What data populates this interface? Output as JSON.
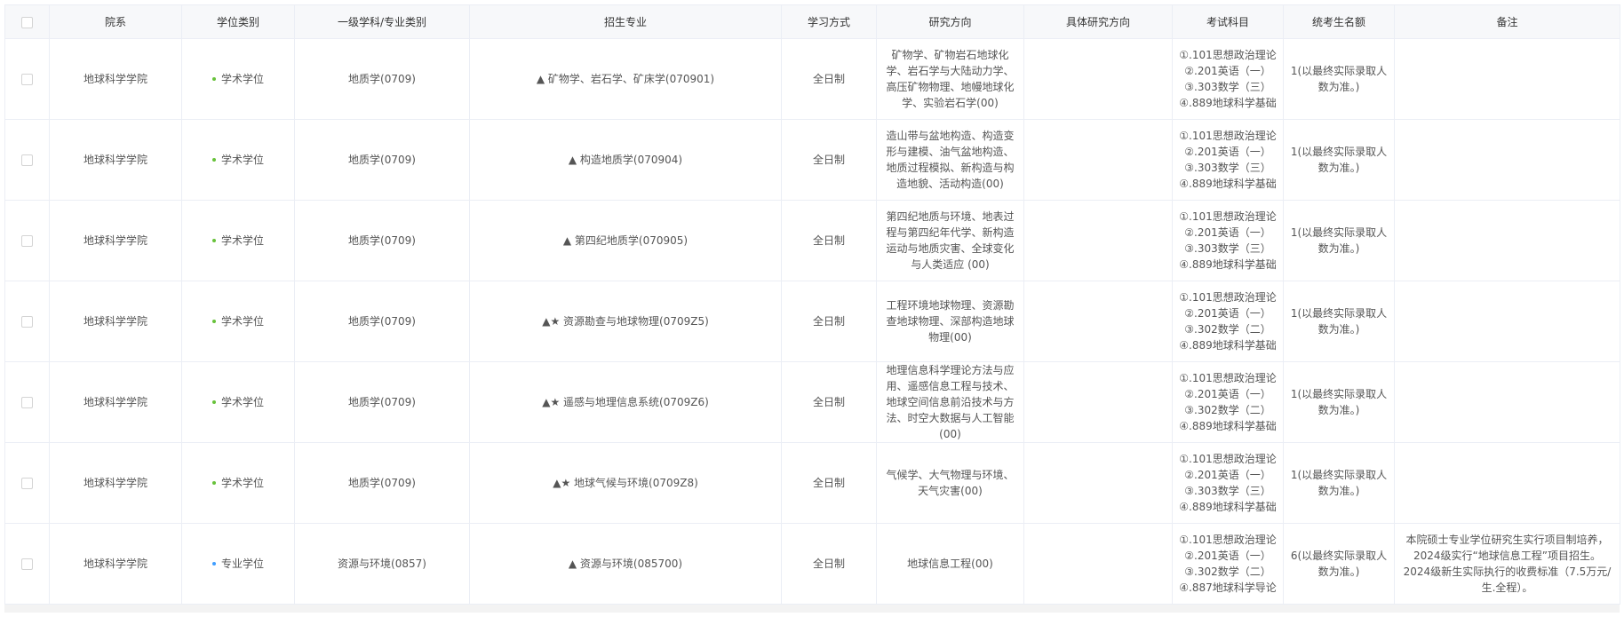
{
  "headers": [
    "院系",
    "学位类别",
    "一级学科/专业类别",
    "招生专业",
    "学习方式",
    "研究方向",
    "具体研究方向",
    "考试科目",
    "统考生名额",
    "备注"
  ],
  "colors": {
    "academic": "#67c23a",
    "professional": "#409eff",
    "border": "#ebeef5",
    "header_bg": "#f7f8fa"
  },
  "rows": [
    {
      "dept": "地球科学学院",
      "degree": "学术学位",
      "degree_kind": "academic",
      "discipline": "地质学(0709)",
      "major": "▲ 矿物学、岩石学、矿床学(070901)",
      "mode": "全日制",
      "direction": "矿物学、矿物岩石地球化学、岩石学与大陆动力学、高压矿物物理、地幔地球化学、实验岩石学(00)",
      "specific": "",
      "subjects": [
        "①.101思想政治理论",
        "②.201英语（一）",
        "③.303数学（三）",
        "④.889地球科学基础"
      ],
      "quota": "1(以最终实际录取人数为准。)",
      "note": ""
    },
    {
      "dept": "地球科学学院",
      "degree": "学术学位",
      "degree_kind": "academic",
      "discipline": "地质学(0709)",
      "major": "▲ 构造地质学(070904)",
      "mode": "全日制",
      "direction": "造山带与盆地构造、构造变形与建模、油气盆地构造、地质过程模拟、新构造与构造地貌、活动构造(00)",
      "specific": "",
      "subjects": [
        "①.101思想政治理论",
        "②.201英语（一）",
        "③.303数学（三）",
        "④.889地球科学基础"
      ],
      "quota": "1(以最终实际录取人数为准。)",
      "note": ""
    },
    {
      "dept": "地球科学学院",
      "degree": "学术学位",
      "degree_kind": "academic",
      "discipline": "地质学(0709)",
      "major": "▲ 第四纪地质学(070905)",
      "mode": "全日制",
      "direction": "第四纪地质与环境、地表过程与第四纪年代学、新构造运动与地质灾害、全球变化与人类适应 (00)",
      "specific": "",
      "subjects": [
        "①.101思想政治理论",
        "②.201英语（一）",
        "③.303数学（三）",
        "④.889地球科学基础"
      ],
      "quota": "1(以最终实际录取人数为准。)",
      "note": ""
    },
    {
      "dept": "地球科学学院",
      "degree": "学术学位",
      "degree_kind": "academic",
      "discipline": "地质学(0709)",
      "major": "▲★ 资源勘查与地球物理(0709Z5)",
      "mode": "全日制",
      "direction": "工程环境地球物理、资源勘查地球物理、深部构造地球物理(00)",
      "specific": "",
      "subjects": [
        "①.101思想政治理论",
        "②.201英语（一）",
        "③.302数学（二）",
        "④.889地球科学基础"
      ],
      "quota": "1(以最终实际录取人数为准。)",
      "note": ""
    },
    {
      "dept": "地球科学学院",
      "degree": "学术学位",
      "degree_kind": "academic",
      "discipline": "地质学(0709)",
      "major": "▲★ 遥感与地理信息系统(0709Z6)",
      "mode": "全日制",
      "direction": "地理信息科学理论方法与应用、遥感信息工程与技术、地球空间信息前沿技术与方法、时空大数据与人工智能(00)",
      "specific": "",
      "subjects": [
        "①.101思想政治理论",
        "②.201英语（一）",
        "③.302数学（二）",
        "④.889地球科学基础"
      ],
      "quota": "1(以最终实际录取人数为准。)",
      "note": ""
    },
    {
      "dept": "地球科学学院",
      "degree": "学术学位",
      "degree_kind": "academic",
      "discipline": "地质学(0709)",
      "major": "▲★ 地球气候与环境(0709Z8)",
      "mode": "全日制",
      "direction": "气候学、大气物理与环境、天气灾害(00)",
      "specific": "",
      "subjects": [
        "①.101思想政治理论",
        "②.201英语（一）",
        "③.303数学（三）",
        "④.889地球科学基础"
      ],
      "quota": "1(以最终实际录取人数为准。)",
      "note": ""
    },
    {
      "dept": "地球科学学院",
      "degree": "专业学位",
      "degree_kind": "professional",
      "discipline": "资源与环境(0857)",
      "major": "▲ 资源与环境(085700)",
      "mode": "全日制",
      "direction": "地球信息工程(00)",
      "specific": "",
      "subjects": [
        "①.101思想政治理论",
        "②.201英语（一）",
        "③.302数学（二）",
        "④.887地球科学导论"
      ],
      "quota": "6(以最终实际录取人数为准。)",
      "note": "本院硕士专业学位研究生实行项目制培养，2024级实行“地球信息工程”项目招生。2024级新生实际执行的收费标准（7.5万元/生.全程）。"
    }
  ]
}
